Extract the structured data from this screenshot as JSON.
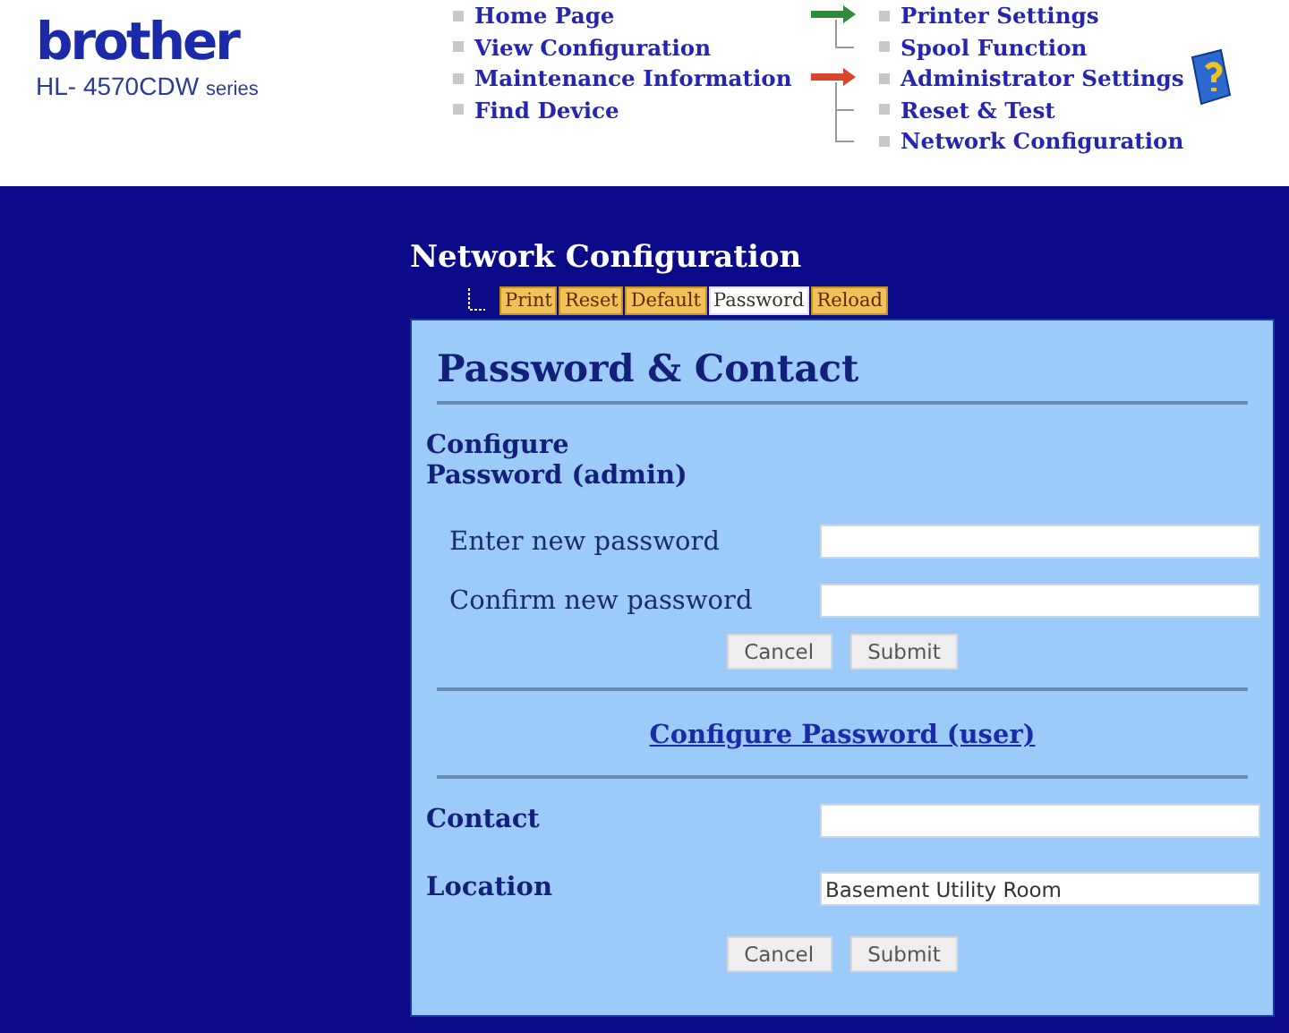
{
  "logo": {
    "brand": "brother",
    "model": "HL- 4570CDW",
    "series": "series"
  },
  "nav_main": [
    "Home Page",
    "View Configuration",
    "Maintenance Information",
    "Find Device"
  ],
  "nav_groups": [
    {
      "color": "#2e8b3a",
      "items": [
        "Printer Settings",
        "Spool Function"
      ]
    },
    {
      "color": "#d8452a",
      "items": [
        "Administrator Settings",
        "Reset & Test",
        "Network Configuration"
      ]
    }
  ],
  "section_title": "Network Configuration",
  "tabs": [
    {
      "label": "Print",
      "selected": false
    },
    {
      "label": "Reset",
      "selected": false
    },
    {
      "label": "Default",
      "selected": false
    },
    {
      "label": "Password",
      "selected": true
    },
    {
      "label": "Reload",
      "selected": false
    }
  ],
  "panel": {
    "title": "Password & Contact",
    "admin": {
      "heading": "Configure Password (admin)",
      "fields": [
        {
          "label": "Enter new password"
        },
        {
          "label": "Confirm new password"
        }
      ],
      "buttons": [
        "Cancel",
        "Submit"
      ]
    },
    "user_link": "Configure Password (user)",
    "contact": {
      "fields": [
        {
          "label": "Contact"
        },
        {
          "label": "Location",
          "value": "Basement Utility Room"
        }
      ],
      "buttons": [
        "Cancel",
        "Submit"
      ]
    }
  }
}
